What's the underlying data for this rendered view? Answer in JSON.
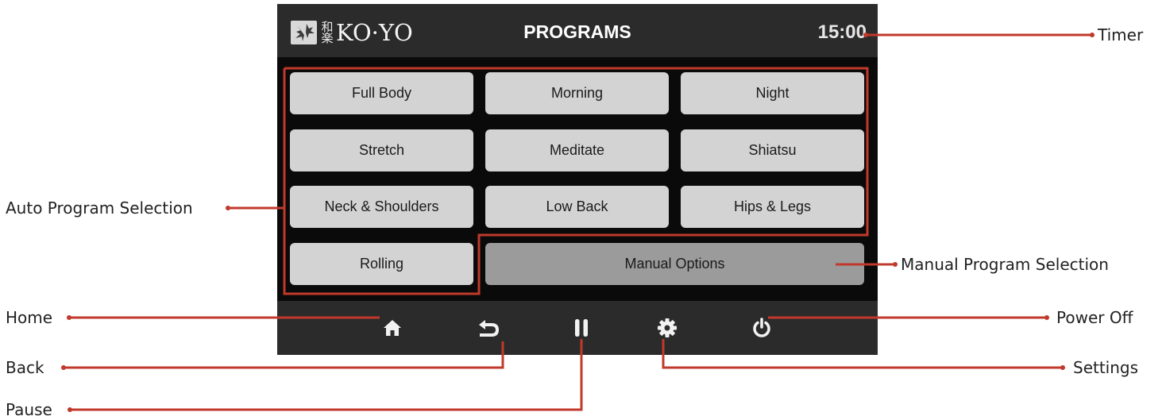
{
  "header": {
    "logo_kanji": "和楽",
    "logo_text": "KO·YO",
    "title": "PROGRAMS",
    "timer": "15:00"
  },
  "programs": [
    {
      "label": "Full Body"
    },
    {
      "label": "Morning"
    },
    {
      "label": "Night"
    },
    {
      "label": "Stretch"
    },
    {
      "label": "Meditate"
    },
    {
      "label": "Shiatsu"
    },
    {
      "label": "Neck & Shoulders"
    },
    {
      "label": "Low Back"
    },
    {
      "label": "Hips & Legs"
    },
    {
      "label": "Rolling"
    }
  ],
  "manual": {
    "label": "Manual Options"
  },
  "footer": {
    "icons": [
      "home-icon",
      "back-arrow-icon",
      "pause-icon",
      "gear-icon",
      "power-icon"
    ]
  },
  "annotations": {
    "timer": "Timer",
    "auto": "Auto Program Selection",
    "manual": "Manual Program Selection",
    "home": "Home",
    "power": "Power Off",
    "back": "Back",
    "settings": "Settings",
    "pause": "Pause"
  },
  "colors": {
    "callout": "#c0392b",
    "screen_bg": "#0a0a0a",
    "bar_bg": "#2b2b2b",
    "button": "#d3d3d3",
    "manual_button": "#9b9b9b"
  }
}
